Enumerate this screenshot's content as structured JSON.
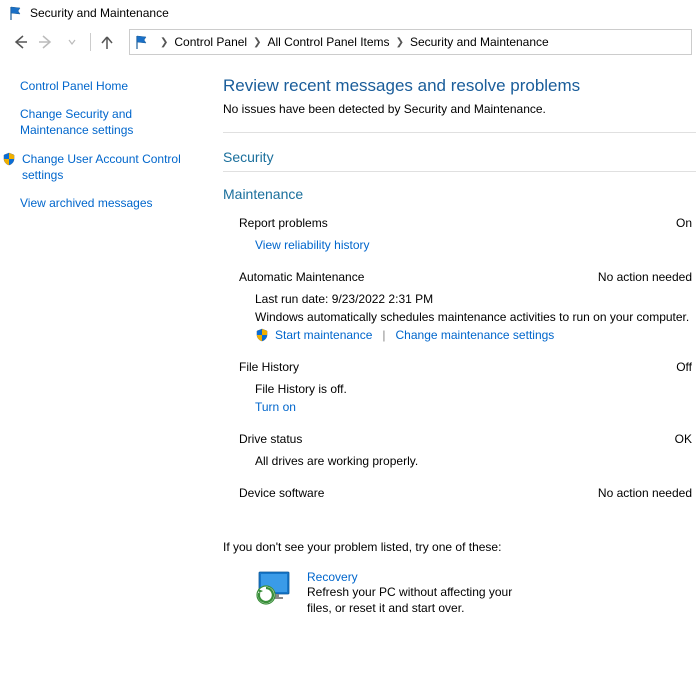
{
  "window": {
    "title": "Security and Maintenance"
  },
  "breadcrumbs": {
    "root": "",
    "items": [
      "Control Panel",
      "All Control Panel Items",
      "Security and Maintenance"
    ]
  },
  "sidebar": {
    "home": "Control Panel Home",
    "change_sec": "Change Security and Maintenance settings",
    "change_uac": "Change User Account Control settings",
    "view_archived": "View archived messages"
  },
  "main": {
    "heading": "Review recent messages and resolve problems",
    "sub": "No issues have been detected by Security and Maintenance.",
    "security_header": "Security",
    "maintenance_header": "Maintenance",
    "report_problems": {
      "label": "Report problems",
      "status": "On",
      "link": "View reliability history"
    },
    "auto_maint": {
      "label": "Automatic Maintenance",
      "status": "No action needed",
      "last_run": "Last run date: 9/23/2022 2:31 PM",
      "desc": "Windows automatically schedules maintenance activities to run on your computer.",
      "start_link": "Start maintenance",
      "change_link": "Change maintenance settings"
    },
    "file_history": {
      "label": "File History",
      "status": "Off",
      "desc": "File History is off.",
      "link": "Turn on"
    },
    "drive_status": {
      "label": "Drive status",
      "status": "OK",
      "desc": "All drives are working properly."
    },
    "device_software": {
      "label": "Device software",
      "status": "No action needed"
    },
    "footer_prompt": "If you don't see your problem listed, try one of these:",
    "recovery": {
      "title": "Recovery",
      "desc": "Refresh your PC without affecting your files, or reset it and start over."
    }
  }
}
